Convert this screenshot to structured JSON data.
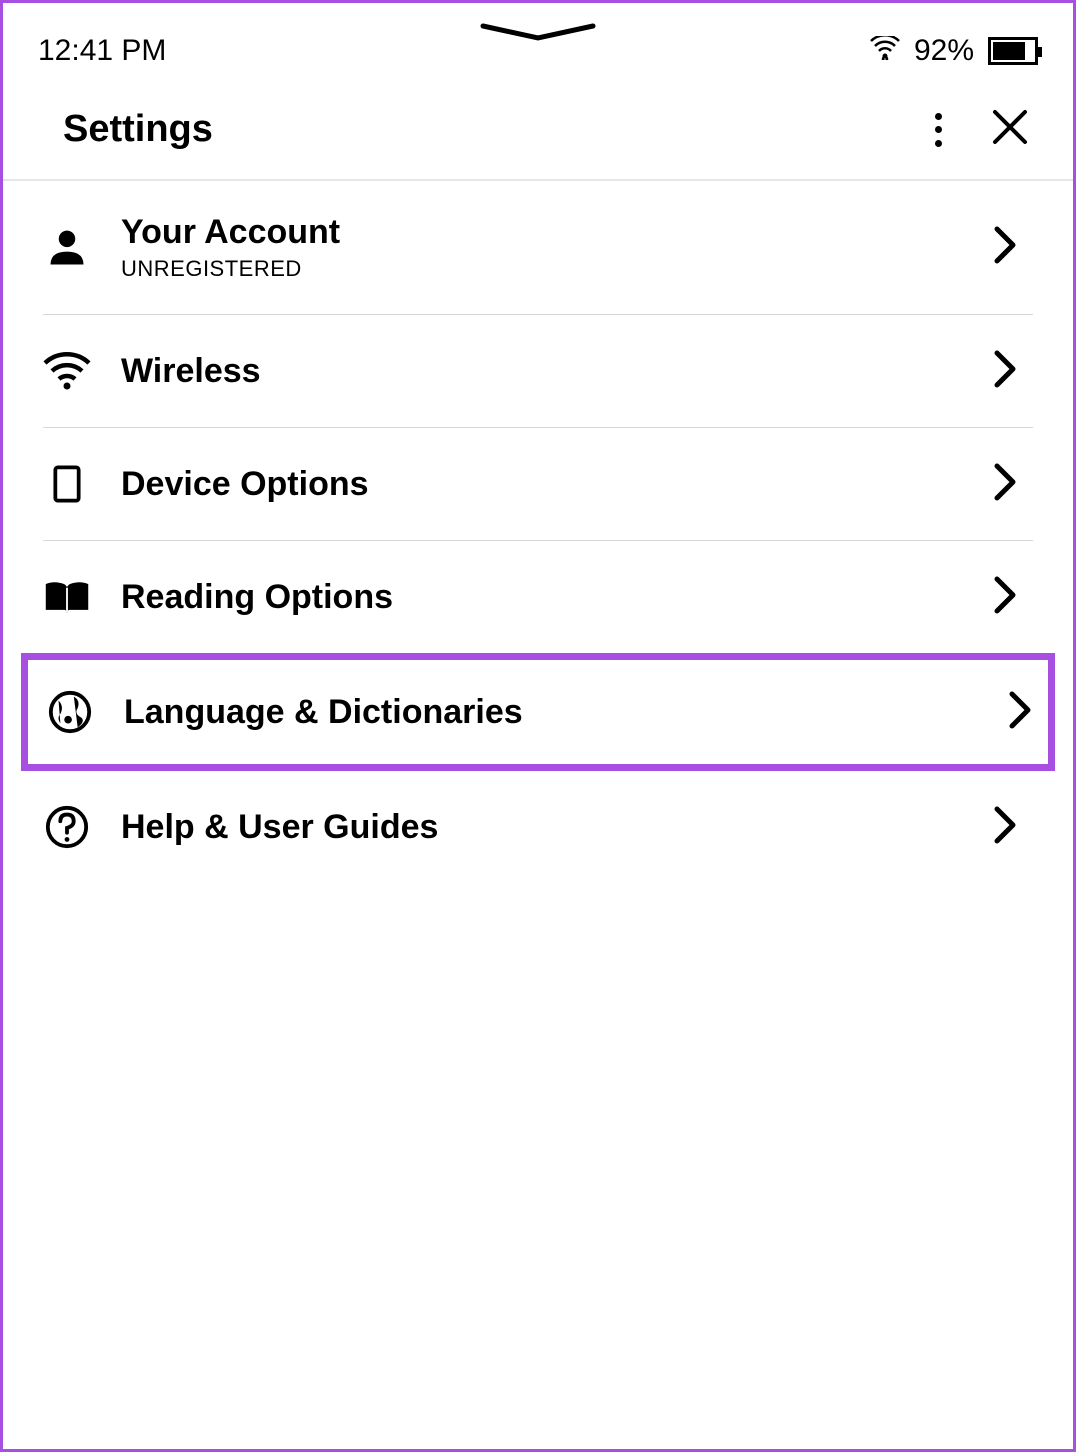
{
  "status": {
    "time": "12:41 PM",
    "battery_pct": "92%"
  },
  "header": {
    "title": "Settings"
  },
  "menu": {
    "items": [
      {
        "label": "Your Account",
        "sub": "UNREGISTERED"
      },
      {
        "label": "Wireless"
      },
      {
        "label": "Device Options"
      },
      {
        "label": "Reading Options"
      },
      {
        "label": "Language & Dictionaries"
      },
      {
        "label": "Help & User Guides"
      }
    ]
  }
}
